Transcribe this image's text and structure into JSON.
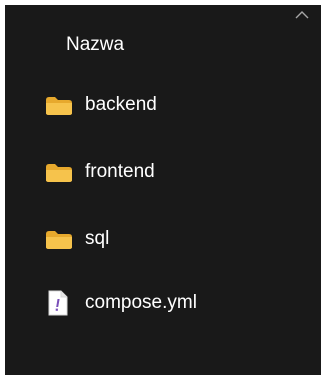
{
  "list": {
    "column_header": "Nazwa",
    "sort_icon": "chevron-up-icon",
    "items": [
      {
        "name": "backend",
        "icon": "folder-icon"
      },
      {
        "name": "frontend",
        "icon": "folder-icon"
      },
      {
        "name": "sql",
        "icon": "folder-icon"
      },
      {
        "name": "compose.yml",
        "icon": "yaml-file-icon"
      }
    ]
  },
  "colors": {
    "background": "#191919",
    "text": "#ffffff",
    "folder": "#f6c34c",
    "folder_tab": "#e7a92d",
    "file_mark": "#7a4fb8"
  }
}
